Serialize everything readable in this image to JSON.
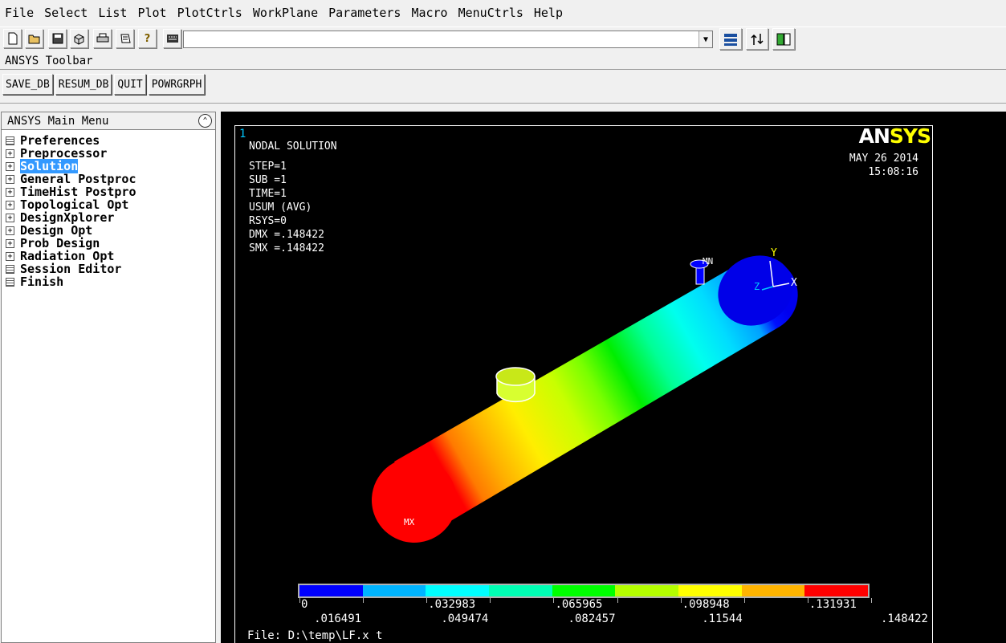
{
  "menubar": [
    "File",
    "Select",
    "List",
    "Plot",
    "PlotCtrls",
    "WorkPlane",
    "Parameters",
    "Macro",
    "MenuCtrls",
    "Help"
  ],
  "toolbar_icons": [
    "new-file-icon",
    "open-folder-icon",
    "save-icon",
    "view-3d-icon",
    "print-icon",
    "report-icon",
    "help-icon",
    "keyboard-icon"
  ],
  "command_input": {
    "value": ""
  },
  "right_icons": [
    "raise-hidden-icon",
    "reset-picking-icon",
    "contact-manager-icon"
  ],
  "ansys_toolbar": {
    "label": "ANSYS Toolbar",
    "buttons": [
      "SAVE_DB",
      "RESUM_DB",
      "QUIT",
      "POWRGRPH"
    ]
  },
  "main_menu": {
    "title": "ANSYS Main Menu",
    "collapse_symbol": "⌃",
    "items": [
      {
        "label": "Preferences",
        "icon": "doc",
        "selected": false
      },
      {
        "label": "Preprocessor",
        "icon": "plus",
        "selected": false
      },
      {
        "label": "Solution",
        "icon": "plus",
        "selected": true
      },
      {
        "label": "General Postproc",
        "icon": "plus",
        "selected": false
      },
      {
        "label": "TimeHist Postpro",
        "icon": "plus",
        "selected": false
      },
      {
        "label": "Topological Opt",
        "icon": "plus",
        "selected": false
      },
      {
        "label": "DesignXplorer",
        "icon": "plus",
        "selected": false
      },
      {
        "label": "Design Opt",
        "icon": "plus",
        "selected": false
      },
      {
        "label": "Prob Design",
        "icon": "plus",
        "selected": false
      },
      {
        "label": "Radiation Opt",
        "icon": "plus",
        "selected": false
      },
      {
        "label": "Session Editor",
        "icon": "doc",
        "selected": false
      },
      {
        "label": "Finish",
        "icon": "doc",
        "selected": false
      }
    ]
  },
  "graphics": {
    "window_number": "1",
    "logo_part1": "AN",
    "logo_part2": "SYS",
    "title": "NODAL SOLUTION",
    "info": [
      "STEP=1",
      "SUB =1",
      "TIME=1",
      "USUM      (AVG)",
      "RSYS=0",
      "DMX =.148422",
      "SMX =.148422"
    ],
    "date": "MAY 26 2014",
    "time": "15:08:16",
    "label_mn": "MN",
    "label_mx": "MX",
    "axis_x": "X",
    "axis_y": "Y",
    "axis_z": "Z",
    "file_label": "File: D:\\temp\\LF.x t",
    "legend_colors": [
      "#0000ff",
      "#00b4ff",
      "#00ffff",
      "#00ffb4",
      "#00ff00",
      "#b4ff00",
      "#ffff00",
      "#ffb400",
      "#ff0000"
    ],
    "legend_top_labels": [
      "0",
      ".032983",
      ".065965",
      ".098948",
      ".131931"
    ],
    "legend_bottom_labels": [
      ".016491",
      ".049474",
      ".082457",
      ".11544",
      ".148422"
    ]
  }
}
